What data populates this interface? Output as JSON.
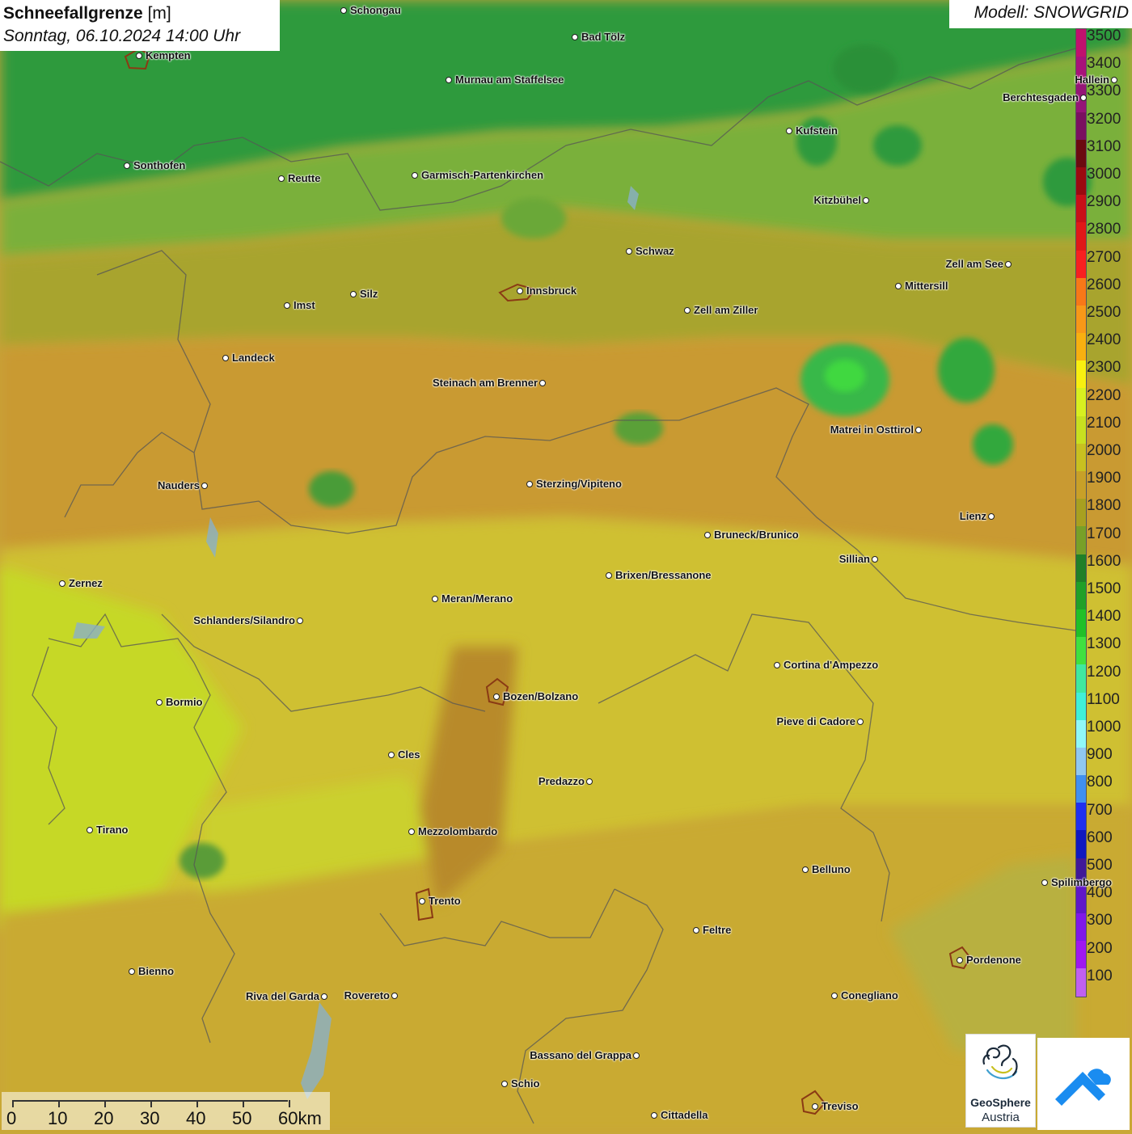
{
  "title": {
    "parameter": "Schneefallgrenze",
    "unit": "[m]",
    "datetime": "Sonntag, 06.10.2024 14:00 Uhr"
  },
  "model": "Modell: SNOWGRID",
  "legend": {
    "levels": [
      "3500",
      "3400",
      "3300",
      "3200",
      "3100",
      "3000",
      "2900",
      "2800",
      "2700",
      "2600",
      "2500",
      "2400",
      "2300",
      "2200",
      "2100",
      "2000",
      "1900",
      "1800",
      "1700",
      "1600",
      "1500",
      "1400",
      "1300",
      "1200",
      "1100",
      "1000",
      "900",
      "800",
      "700",
      "600",
      "500",
      "400",
      "300",
      "200",
      "100"
    ],
    "colors": [
      "#c0116e",
      "#a8137a",
      "#951577",
      "#7a1060",
      "#6b0a10",
      "#9a0a10",
      "#c81018",
      "#e01818",
      "#f82020",
      "#f87818",
      "#f89818",
      "#f8b010",
      "#f8f010",
      "#d8f020",
      "#c8e020",
      "#c8c020",
      "#c8a028",
      "#a8a020",
      "#78a028",
      "#208028",
      "#20a028",
      "#20c028",
      "#40e040",
      "#40e8a0",
      "#40f0d8",
      "#90f8f8",
      "#90c8f0",
      "#4090f0",
      "#2030f0",
      "#1018c0",
      "#401898",
      "#6018c8",
      "#8018e8",
      "#a018f0",
      "#c060f0"
    ]
  },
  "cities": [
    {
      "name": "Schongau",
      "label_side": "right"
    },
    {
      "name": "Bad Tölz",
      "label_side": "right"
    },
    {
      "name": "Kempten",
      "label_side": "right"
    },
    {
      "name": "Murnau am Staffelsee",
      "label_side": "right"
    },
    {
      "name": "Hallein",
      "label_side": "left"
    },
    {
      "name": "Berchtesgaden",
      "label_side": "left"
    },
    {
      "name": "Kufstein",
      "label_side": "right"
    },
    {
      "name": "Sonthofen",
      "label_side": "right"
    },
    {
      "name": "Reutte",
      "label_side": "right"
    },
    {
      "name": "Garmisch-Partenkirchen",
      "label_side": "right"
    },
    {
      "name": "Kitzbühel",
      "label_side": "left"
    },
    {
      "name": "Schwaz",
      "label_side": "right"
    },
    {
      "name": "Zell am See",
      "label_side": "left"
    },
    {
      "name": "Innsbruck",
      "label_side": "right"
    },
    {
      "name": "Mittersill",
      "label_side": "right"
    },
    {
      "name": "Imst",
      "label_side": "right"
    },
    {
      "name": "Silz",
      "label_side": "right"
    },
    {
      "name": "Zell am Ziller",
      "label_side": "right"
    },
    {
      "name": "Landeck",
      "label_side": "right"
    },
    {
      "name": "Steinach am Brenner",
      "label_side": "left"
    },
    {
      "name": "Matrei in Osttirol",
      "label_side": "left"
    },
    {
      "name": "Nauders",
      "label_side": "left"
    },
    {
      "name": "Sterzing/Vipiteno",
      "label_side": "right"
    },
    {
      "name": "Lienz",
      "label_side": "left"
    },
    {
      "name": "Bruneck/Brunico",
      "label_side": "right"
    },
    {
      "name": "Sillian",
      "label_side": "left"
    },
    {
      "name": "Zernez",
      "label_side": "right"
    },
    {
      "name": "Brixen/Bressanone",
      "label_side": "right"
    },
    {
      "name": "Meran/Merano",
      "label_side": "right"
    },
    {
      "name": "Schlanders/Silandro",
      "label_side": "left"
    },
    {
      "name": "Cortina d'Ampezzo",
      "label_side": "right"
    },
    {
      "name": "Bozen/Bolzano",
      "label_side": "right"
    },
    {
      "name": "Bormio",
      "label_side": "right"
    },
    {
      "name": "Pieve di Cadore",
      "label_side": "left"
    },
    {
      "name": "Cles",
      "label_side": "right"
    },
    {
      "name": "Predazzo",
      "label_side": "left"
    },
    {
      "name": "Tirano",
      "label_side": "right"
    },
    {
      "name": "Mezzolombardo",
      "label_side": "right"
    },
    {
      "name": "Belluno",
      "label_side": "right"
    },
    {
      "name": "Spilimbergo",
      "label_side": "right"
    },
    {
      "name": "Trento",
      "label_side": "right"
    },
    {
      "name": "Feltre",
      "label_side": "right"
    },
    {
      "name": "Pordenone",
      "label_side": "right"
    },
    {
      "name": "Bienno",
      "label_side": "right"
    },
    {
      "name": "Riva del Garda",
      "label_side": "left"
    },
    {
      "name": "Rovereto",
      "label_side": "left"
    },
    {
      "name": "Conegliano",
      "label_side": "right"
    },
    {
      "name": "Bassano del Grappa",
      "label_side": "left"
    },
    {
      "name": "Schio",
      "label_side": "right"
    },
    {
      "name": "Treviso",
      "label_side": "right"
    },
    {
      "name": "Cittadella",
      "label_side": "right"
    }
  ],
  "scale": {
    "labels": [
      "0",
      "10",
      "20",
      "30",
      "40",
      "50",
      "60km"
    ]
  },
  "logos": {
    "geosphere_line1": "GeoSphere",
    "geosphere_line2": "Austria"
  }
}
